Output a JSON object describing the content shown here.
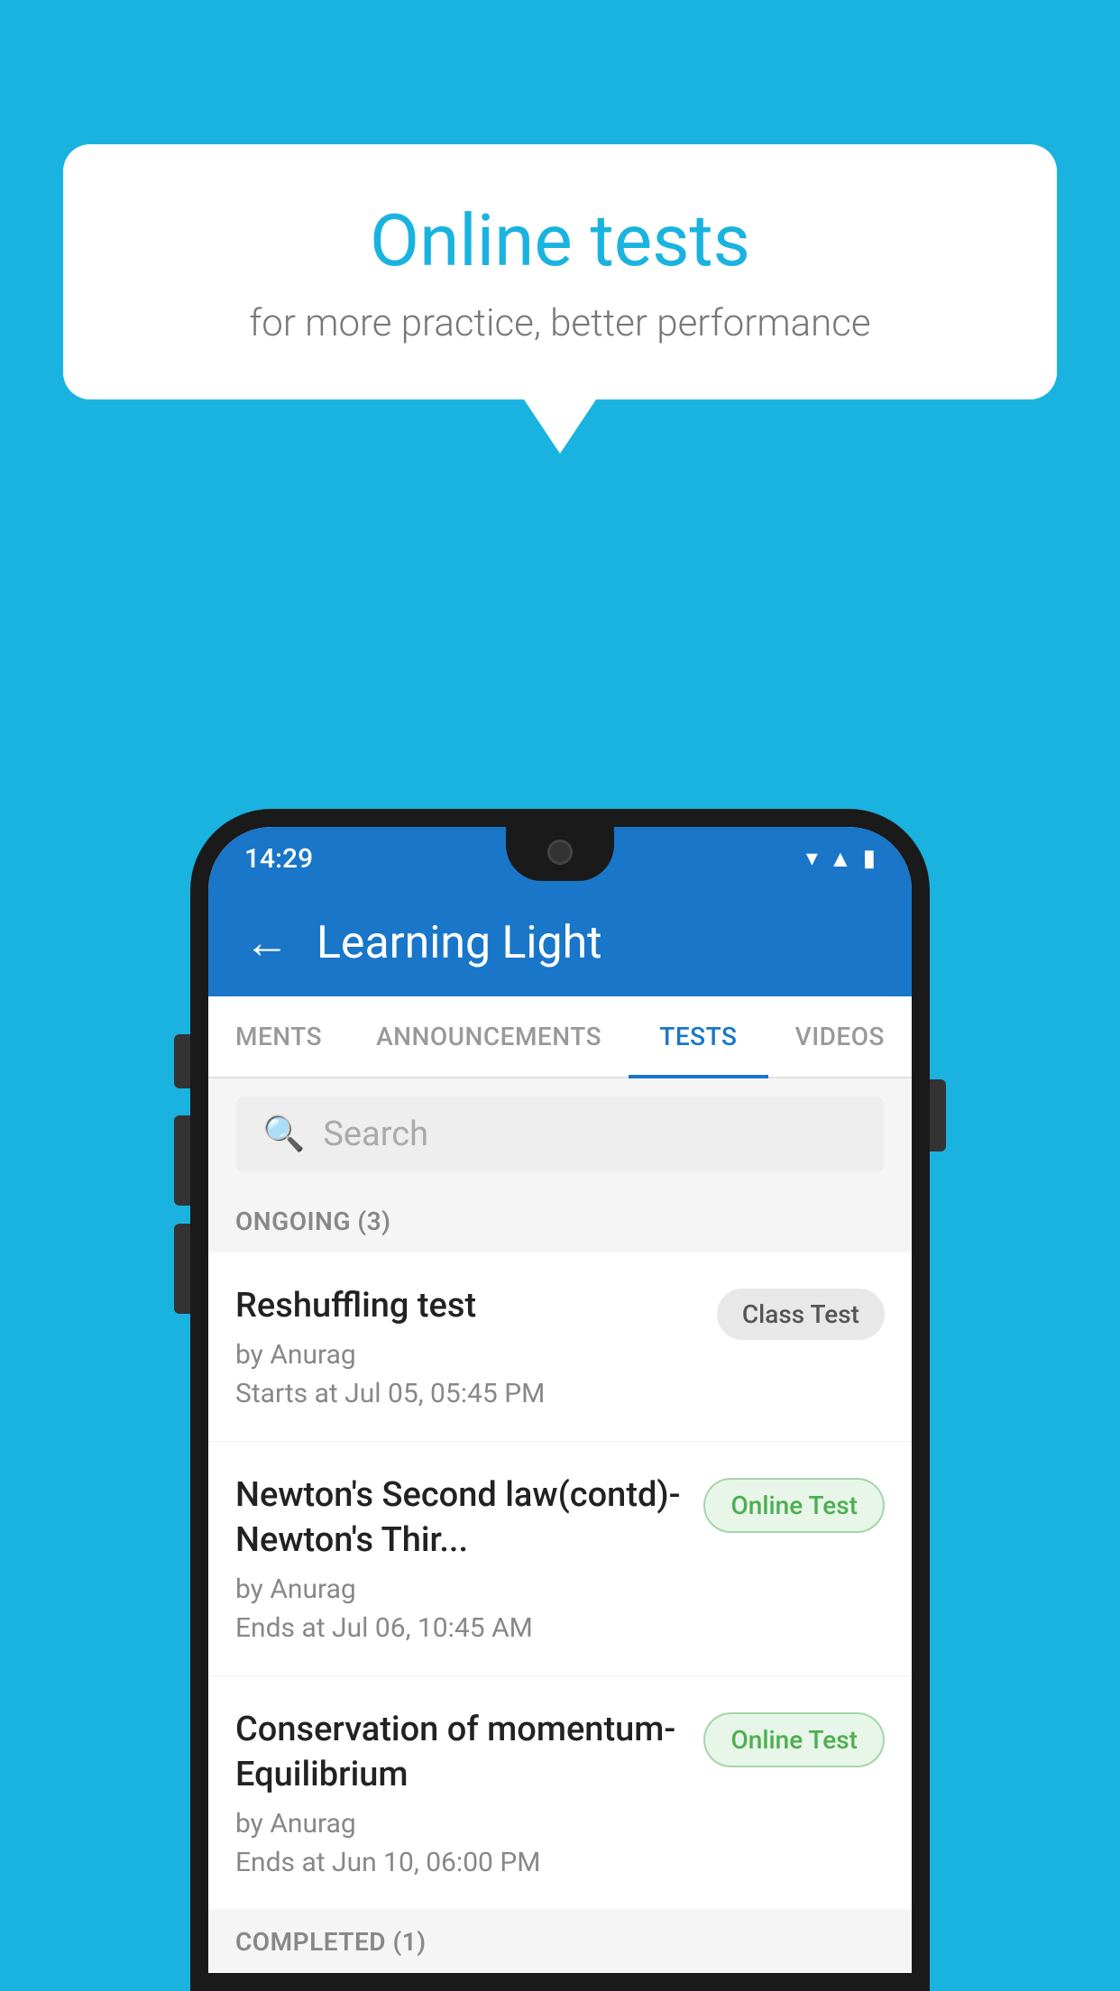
{
  "background_color": "#1ab3e0",
  "speech_bubble": {
    "title": "Online tests",
    "subtitle": "for more practice, better performance"
  },
  "phone": {
    "status_bar": {
      "time": "14:29",
      "icons": [
        "wifi",
        "signal",
        "battery"
      ]
    },
    "app_header": {
      "title": "Learning Light",
      "back_label": "←"
    },
    "tabs": [
      {
        "label": "MENTS",
        "active": false
      },
      {
        "label": "ANNOUNCEMENTS",
        "active": false
      },
      {
        "label": "TESTS",
        "active": true
      },
      {
        "label": "VIDEOS",
        "active": false
      }
    ],
    "search": {
      "placeholder": "Search"
    },
    "ongoing_section": {
      "label": "ONGOING (3)"
    },
    "tests": [
      {
        "name": "Reshuffling test",
        "author": "by Anurag",
        "date": "Starts at  Jul 05, 05:45 PM",
        "badge": "Class Test",
        "badge_type": "class"
      },
      {
        "name": "Newton's Second law(contd)-Newton's Thir...",
        "author": "by Anurag",
        "date": "Ends at  Jul 06, 10:45 AM",
        "badge": "Online Test",
        "badge_type": "online"
      },
      {
        "name": "Conservation of momentum-Equilibrium",
        "author": "by Anurag",
        "date": "Ends at  Jun 10, 06:00 PM",
        "badge": "Online Test",
        "badge_type": "online"
      }
    ],
    "completed_section": {
      "label": "COMPLETED (1)"
    }
  }
}
